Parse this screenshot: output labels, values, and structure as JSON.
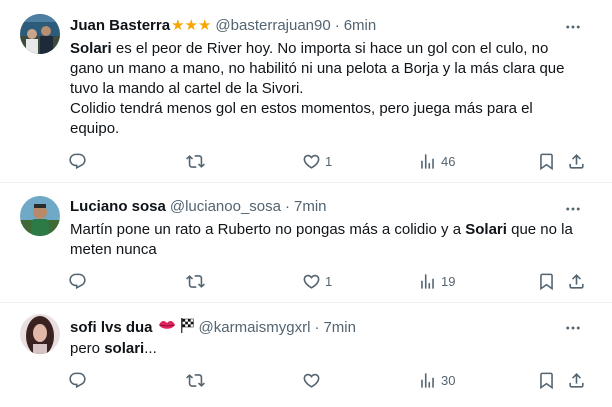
{
  "tweets": [
    {
      "name": "Juan Basterra",
      "badge": "★★★",
      "handle": "@basterrajuan90",
      "dot": "·",
      "time": "6min",
      "lines": [
        {
          "bold": "Solari",
          "rest": " es el peor de River hoy. No importa si hace un gol con el culo, no"
        },
        {
          "bold": "",
          "rest": "gano un mano a mano, no habilitó  ni una pelota a Borja y la más clara que"
        },
        {
          "bold": "",
          "rest": "tuvo la mando al cartel de la Sivori."
        },
        {
          "bold": "",
          "rest": "Colidio tendrá menos gol en estos momentos, pero juega más para el"
        },
        {
          "bold": "",
          "rest": "equipo."
        }
      ],
      "counts": {
        "reply": "",
        "retweet": "",
        "like": "1",
        "views": "46"
      }
    },
    {
      "name": "Luciano sosa",
      "handle": "@lucianoo_sosa",
      "dot": "·",
      "time": "7min",
      "line1": "Martín pone un rato a Ruberto no pongas más a colidio y a ",
      "line1_bold": "Solari",
      "line1_end": " que no la",
      "line2": "meten nunca",
      "counts": {
        "reply": "",
        "retweet": "",
        "like": "1",
        "views": "19"
      }
    },
    {
      "name": "sofi lvs dua",
      "handle": "@karmaismygxrl",
      "dot": "·",
      "time": "7min",
      "text_start": "pero ",
      "text_bold": "solari",
      "text_end": "...",
      "counts": {
        "reply": "",
        "retweet": "",
        "like": "",
        "views": "30"
      }
    }
  ],
  "icons": [
    "more-icon",
    "reply-icon",
    "retweet-icon",
    "like-icon",
    "views-icon",
    "bookmark-icon",
    "share-icon",
    "lips-emoji",
    "checkered-flag-emoji"
  ]
}
